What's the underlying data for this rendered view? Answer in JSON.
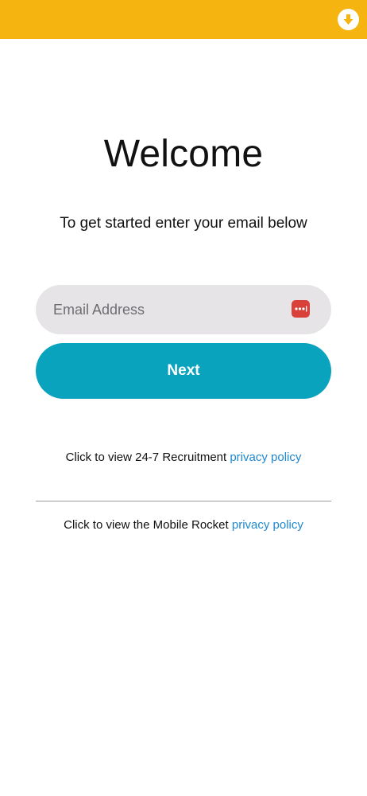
{
  "header": {
    "download_icon": "download-arrow-circle-icon",
    "bar_color": "#F5B40F"
  },
  "main": {
    "title": "Welcome",
    "subtitle": "To get started enter your email below",
    "email": {
      "placeholder": "Email Address",
      "value": "",
      "autofill_icon": "password-manager-icon"
    },
    "next_label": "Next",
    "accent_color": "#0AA3BE"
  },
  "privacy": {
    "line1_prefix": "Click to view 24-7 Recruitment ",
    "line1_link": "privacy policy",
    "line2_prefix": "Click to view the Mobile Rocket ",
    "line2_link": "privacy policy",
    "link_color": "#1E88D0"
  }
}
